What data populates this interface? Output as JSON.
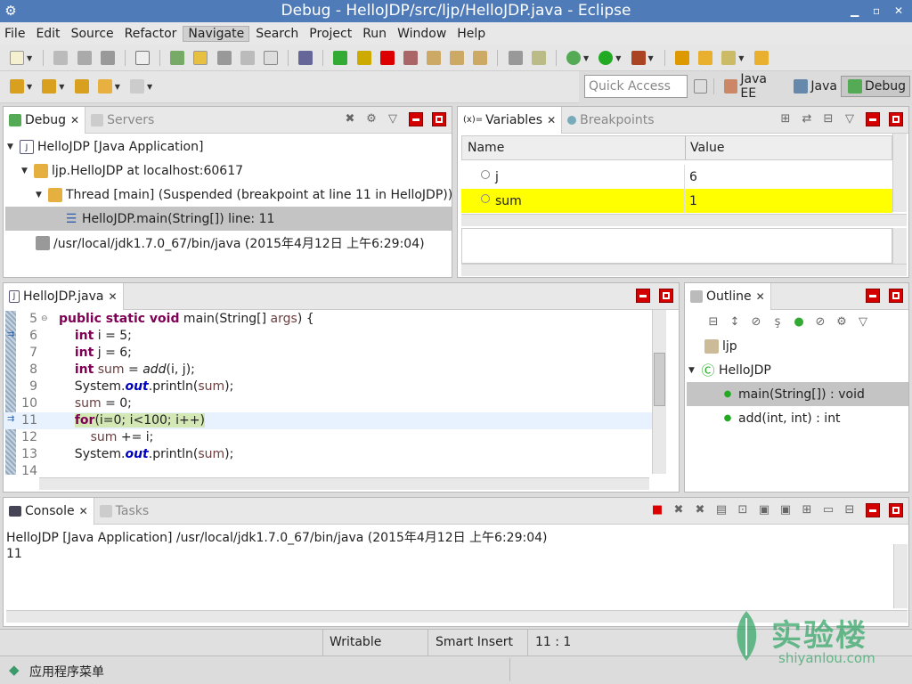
{
  "window": {
    "title": "Debug - HelloJDP/src/ljp/HelloJDP.java - Eclipse"
  },
  "menu": [
    "File",
    "Edit",
    "Source",
    "Refactor",
    "Navigate",
    "Search",
    "Project",
    "Run",
    "Window",
    "Help"
  ],
  "quick_access": {
    "placeholder": "Quick Access"
  },
  "perspectives": [
    {
      "label": "Java EE"
    },
    {
      "label": "Java"
    },
    {
      "label": "Debug",
      "active": true
    }
  ],
  "debug_view": {
    "tabs": [
      "Debug",
      "Servers"
    ],
    "tree": [
      "HelloJDP [Java Application]",
      "ljp.HelloJDP at localhost:60617",
      "Thread [main] (Suspended (breakpoint at line 11 in HelloJDP))",
      "HelloJDP.main(String[]) line: 11",
      "/usr/local/jdk1.7.0_67/bin/java (2015年4月12日 上午6:29:04)"
    ]
  },
  "variables_view": {
    "tabs": [
      "Variables",
      "Breakpoints"
    ],
    "tab_prefix": "(x)=",
    "columns": [
      "Name",
      "Value"
    ],
    "rows": [
      {
        "name": "j",
        "value": "6"
      },
      {
        "name": "sum",
        "value": "1",
        "highlight": "#ffff00"
      }
    ]
  },
  "editor": {
    "tab": "HelloJDP.java",
    "lines": [
      "5",
      "6",
      "7",
      "8",
      "9",
      "10",
      "11",
      "12",
      "13",
      "14"
    ]
  },
  "outline": {
    "tab": "Outline",
    "items": [
      "ljp",
      "HelloJDP",
      "main(String[]) : void",
      "add(int, int) : int"
    ]
  },
  "console": {
    "tabs": [
      "Console",
      "Tasks"
    ],
    "header": "HelloJDP [Java Application] /usr/local/jdk1.7.0_67/bin/java (2015年4月12日 上午6:29:04)",
    "output": "11"
  },
  "statusbar": {
    "writable": "Writable",
    "insert_mode": "Smart Insert",
    "position": "11 : 1"
  },
  "taskbar": {
    "menu": "应用程序菜单"
  },
  "watermark": {
    "cn": "实验楼",
    "url": "shiyanlou.com"
  },
  "colors": {
    "title_bg": "#4f7bb8",
    "highlight": "#ffff00",
    "keyword": "#7f0055",
    "current_line": "#d4e8b6",
    "close_red": "#d40000"
  }
}
